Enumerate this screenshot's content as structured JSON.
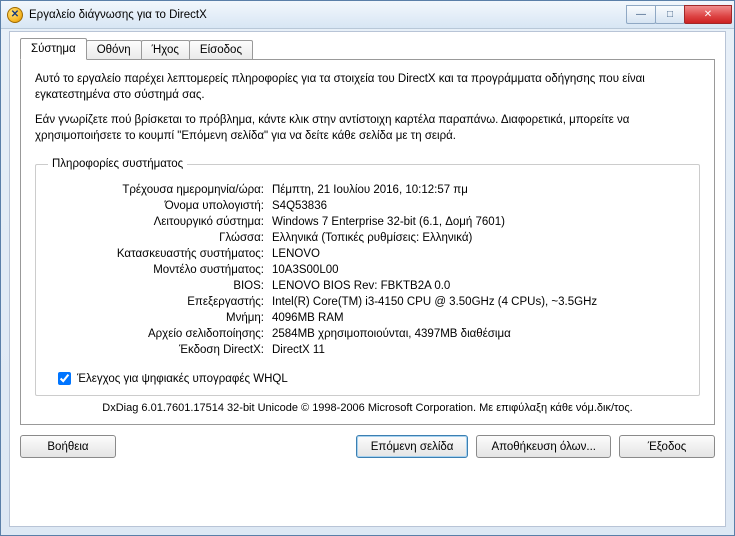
{
  "window": {
    "title": "Εργαλείο διάγνωσης για το DirectX"
  },
  "tabs": [
    {
      "label": "Σύστημα"
    },
    {
      "label": "Οθόνη"
    },
    {
      "label": "Ήχος"
    },
    {
      "label": "Είσοδος"
    }
  ],
  "intro": {
    "p1": "Αυτό το εργαλείο παρέχει λεπτομερείς πληροφορίες για τα στοιχεία του DirectX και τα προγράμματα οδήγησης που είναι εγκατεστημένα στο σύστημά σας.",
    "p2": "Εάν γνωρίζετε πού βρίσκεται το πρόβλημα, κάντε κλικ στην αντίστοιχη καρτέλα παραπάνω.  Διαφορετικά, μπορείτε να χρησιμοποιήσετε το κουμπί \"Επόμενη σελίδα\" για να δείτε κάθε σελίδα με τη σειρά."
  },
  "group": {
    "legend": "Πληροφορίες συστήματος"
  },
  "rows": {
    "datetime": {
      "label": "Τρέχουσα ημερομηνία/ώρα:",
      "value": "Πέμπτη, 21 Ιουλίου 2016, 10:12:57 πμ"
    },
    "computer": {
      "label": "Όνομα υπολογιστή:",
      "value": "S4Q53836"
    },
    "os": {
      "label": "Λειτουργικό σύστημα:",
      "value": "Windows 7 Enterprise 32-bit (6.1, Δομή 7601)"
    },
    "lang": {
      "label": "Γλώσσα:",
      "value": "Ελληνικά (Τοπικές ρυθμίσεις: Ελληνικά)"
    },
    "mfr": {
      "label": "Κατασκευαστής συστήματος:",
      "value": "LENOVO"
    },
    "model": {
      "label": "Μοντέλο συστήματος:",
      "value": "10A3S00L00"
    },
    "bios": {
      "label": "BIOS:",
      "value": "LENOVO BIOS Rev: FBKTB2A 0.0"
    },
    "cpu": {
      "label": "Επεξεργαστής:",
      "value": "Intel(R) Core(TM) i3-4150 CPU @ 3.50GHz (4 CPUs), ~3.5GHz"
    },
    "mem": {
      "label": "Μνήμη:",
      "value": "4096MB RAM"
    },
    "pagefile": {
      "label": "Αρχείο σελιδοποίησης:",
      "value": "2584MB χρησιμοποιούνται, 4397MB διαθέσιμα"
    },
    "dxver": {
      "label": "Έκδοση DirectX:",
      "value": "DirectX 11"
    }
  },
  "whql": {
    "label": "Έλεγχος για ψηφιακές υπογραφές WHQL"
  },
  "footer": {
    "text": "DxDiag 6.01.7601.17514 32-bit Unicode © 1998-2006 Microsoft Corporation. Με επιφύλαξη κάθε νόμ.δικ/τος."
  },
  "buttons": {
    "help": "Βοήθεια",
    "next": "Επόμενη σελίδα",
    "saveall": "Αποθήκευση όλων...",
    "exit": "Έξοδος"
  }
}
